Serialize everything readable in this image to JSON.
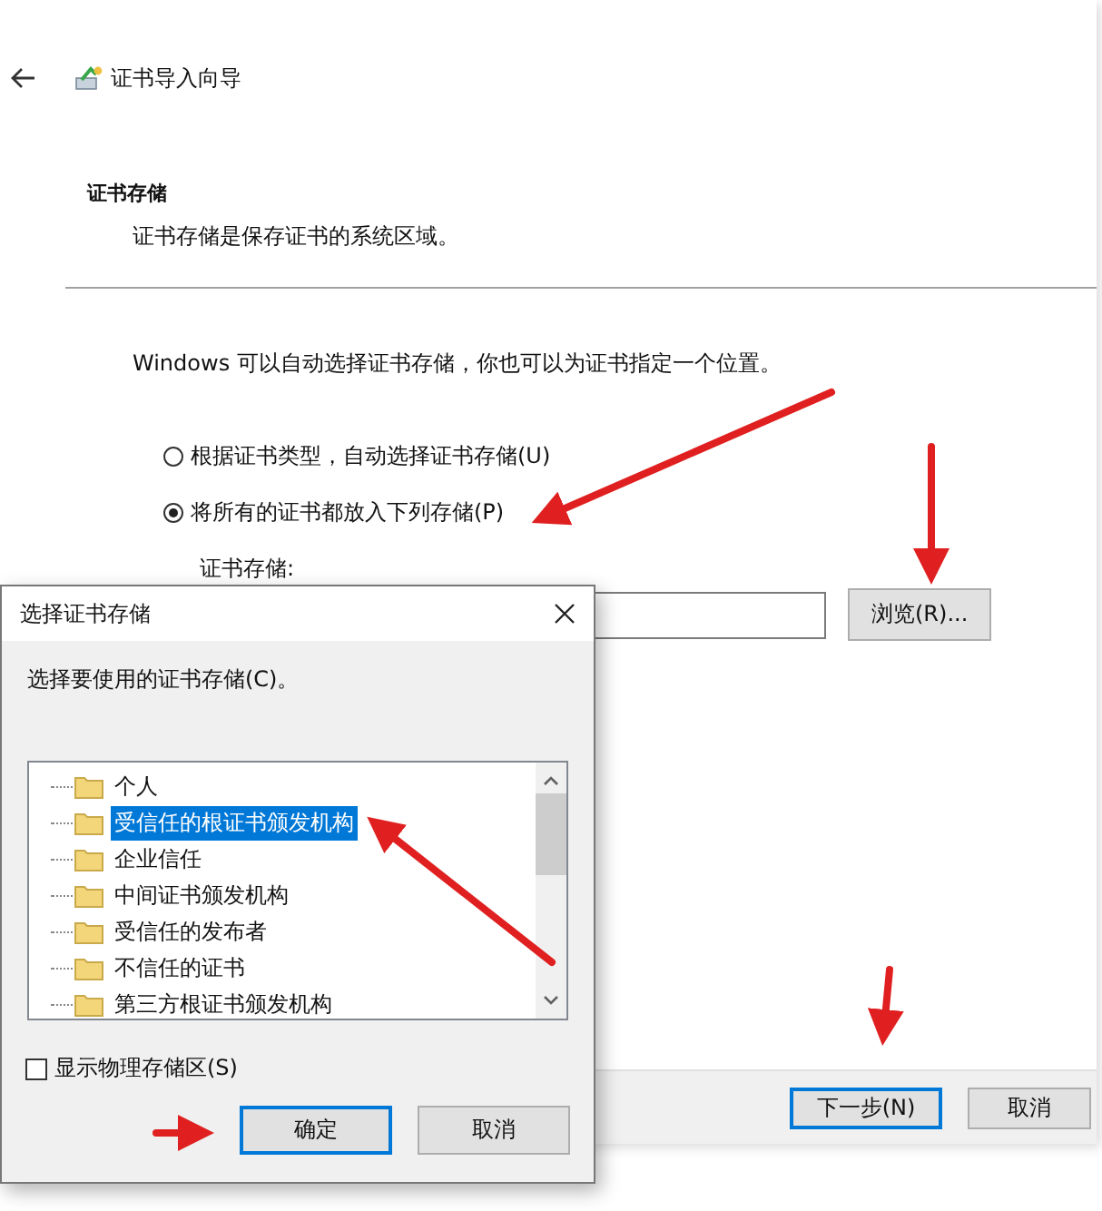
{
  "wizard": {
    "title": "证书导入向导",
    "heading": "证书存储",
    "subheading": "证书存储是保存证书的系统区域。",
    "intro": "Windows 可以自动选择证书存储，你也可以为证书指定一个位置。",
    "options": [
      {
        "label": "根据证书类型，自动选择证书存储(U)",
        "selected": false
      },
      {
        "label": "将所有的证书都放入下列存储(P)",
        "selected": true
      }
    ],
    "store_label": "证书存储:",
    "browse_button": "浏览(R)...",
    "buttons": [
      {
        "label": "下一步(N)",
        "default": true
      },
      {
        "label": "取消",
        "default": false
      }
    ]
  },
  "dialog": {
    "title": "选择证书存储",
    "prompt": "选择要使用的证书存储(C)。",
    "stores": [
      {
        "label": "个人",
        "selected": false
      },
      {
        "label": "受信任的根证书颁发机构",
        "selected": true
      },
      {
        "label": "企业信任",
        "selected": false
      },
      {
        "label": "中间证书颁发机构",
        "selected": false
      },
      {
        "label": "受信任的发布者",
        "selected": false
      },
      {
        "label": "不信任的证书",
        "selected": false
      },
      {
        "label": "第三方根证书颁发机构",
        "selected": false
      }
    ],
    "show_physical": {
      "label": "显示物理存储区(S)",
      "checked": false
    },
    "buttons": [
      {
        "label": "确定",
        "default": true
      },
      {
        "label": "取消",
        "default": false
      }
    ]
  }
}
